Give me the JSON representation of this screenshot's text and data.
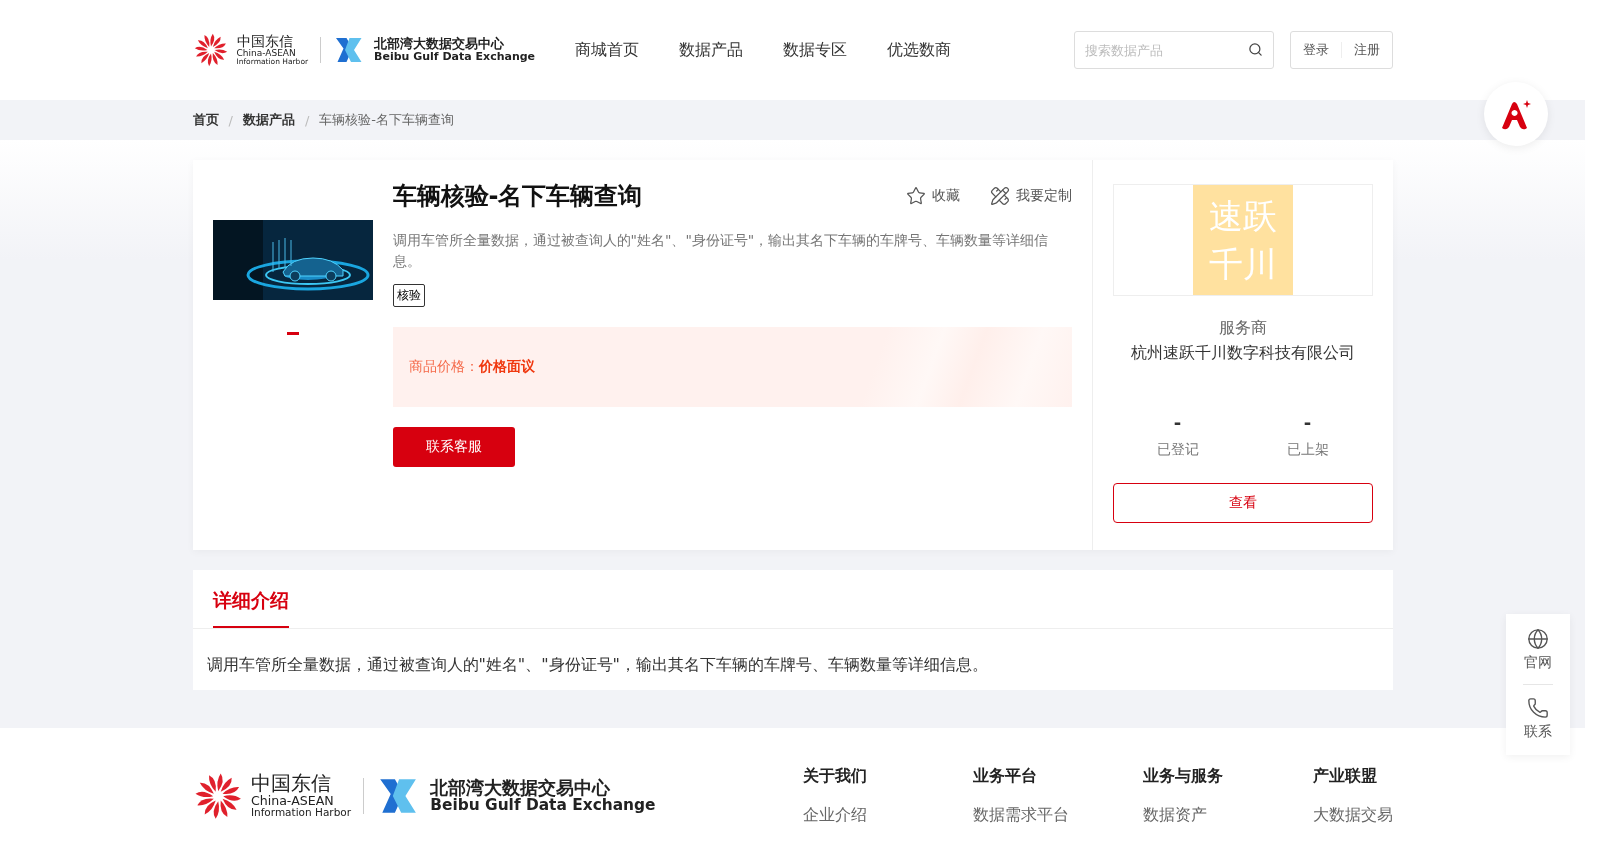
{
  "header": {
    "logo_a": {
      "cn": "中国东信",
      "en1": "China-ASEAN",
      "en2": "Information Harbor"
    },
    "logo_b": {
      "cn": "北部湾大数据交易中心",
      "en": "Beibu Gulf Data Exchange"
    },
    "nav": [
      {
        "label": "商城首页",
        "selected": false
      },
      {
        "label": "数据产品",
        "selected": false
      },
      {
        "label": "数据专区",
        "selected": false
      },
      {
        "label": "优选数商",
        "selected": false
      }
    ],
    "search": {
      "placeholder": "搜索数据产品"
    },
    "login": "登录",
    "register": "注册"
  },
  "breadcrumb": {
    "items": [
      "首页",
      "数据产品",
      "车辆核验-名下车辆查询"
    ],
    "separators": [
      "/",
      "/"
    ]
  },
  "product": {
    "title": "车辆核验-名下车辆查询",
    "favorite": "收藏",
    "customize": "我要定制",
    "description": "调用车管所全量数据，通过被查询人的\"姓名\"、\"身份证号\"，输出其名下车辆的车牌号、车辆数量等详细信息。",
    "tags": [
      "核验"
    ],
    "price_label": "商品价格：",
    "price": "价格面议",
    "contact": "联系客服"
  },
  "provider": {
    "logo_lines": [
      "速跃",
      "千川"
    ],
    "label": "服务商",
    "name": "杭州速跃千川数字科技有限公司",
    "stats": [
      {
        "value": "-",
        "label": "已登记"
      },
      {
        "value": "-",
        "label": "已上架"
      }
    ],
    "view": "查看"
  },
  "detail": {
    "tabs": [
      {
        "label": "详细介绍",
        "selected": true
      }
    ],
    "text": "调用车管所全量数据，通过被查询人的\"姓名\"、\"身份证号\"，输出其名下车辆的车牌号、车辆数量等详细信息。"
  },
  "side_tools": [
    {
      "kind": "globe",
      "label": "官网"
    },
    {
      "kind": "phone",
      "label": "联系"
    }
  ],
  "footer": {
    "logo_a": {
      "cn": "中国东信",
      "en1": "China-ASEAN",
      "en2": "Information Harbor"
    },
    "logo_b": {
      "cn": "北部湾大数据交易中心",
      "en": "Beibu Gulf Data Exchange"
    },
    "columns": [
      {
        "title": "关于我们",
        "links": [
          "企业介绍"
        ]
      },
      {
        "title": "业务平台",
        "links": [
          "数据需求平台"
        ]
      },
      {
        "title": "业务与服务",
        "links": [
          "数据资产"
        ]
      },
      {
        "title": "产业联盟",
        "links": [
          "大数据交易"
        ]
      }
    ]
  }
}
